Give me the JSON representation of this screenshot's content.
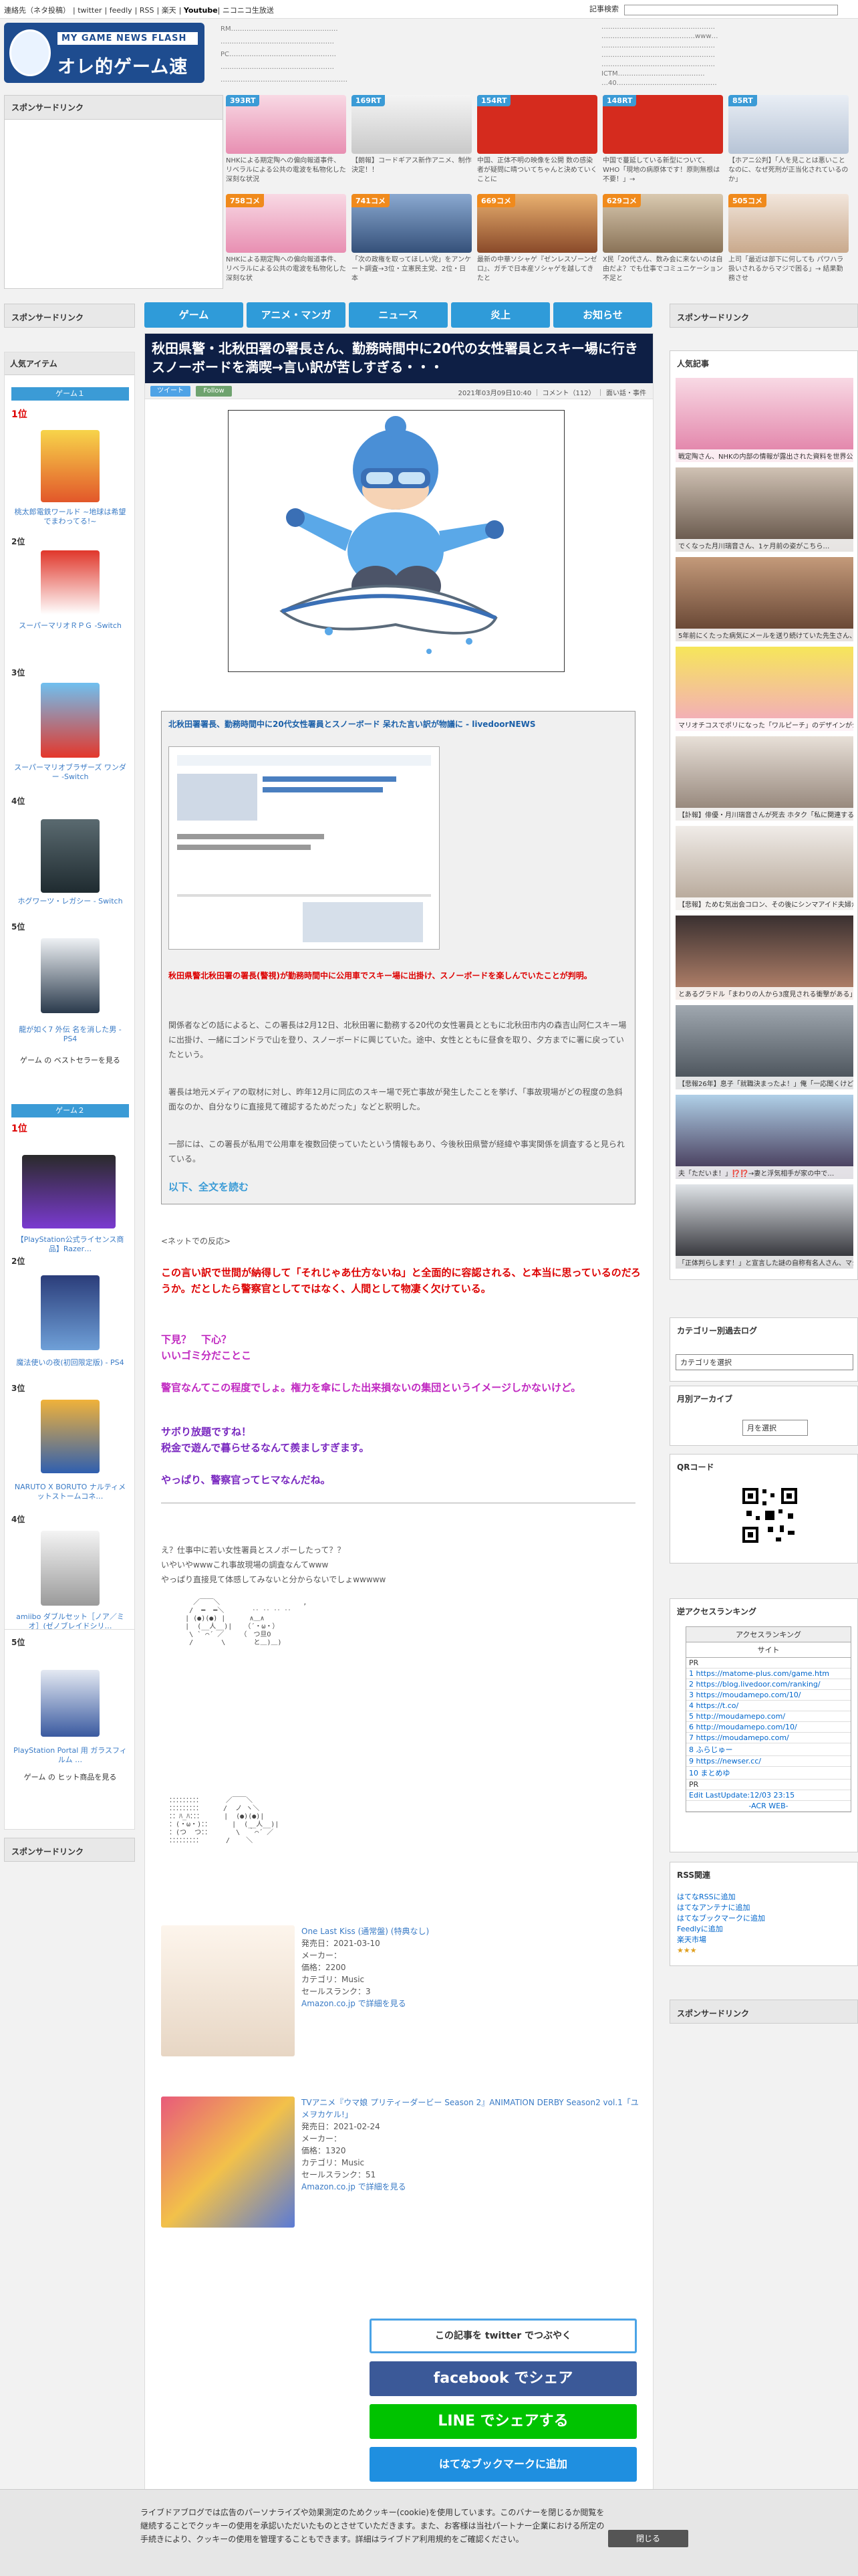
{
  "topbar": {
    "links": [
      "連絡先（ネタ投稿）",
      "twitter",
      "feedly",
      "RSS",
      "楽天",
      "Youtube",
      "ニコニコ生放送"
    ],
    "search_label": "記事検索"
  },
  "logo": {
    "line1": "MY GAME NEWS FLASH",
    "line2": "オレ的ゲーム速報@JIN"
  },
  "headlines_left": [
    "RM…………………………………………",
    "……………………………………………",
    "PC…………………………………………",
    "……………………………………………",
    "…………………………………………………"
  ],
  "headlines_right": [
    "……………………………………………",
    "……………………………………www…",
    "……………………………………………",
    "……………………………………………",
    "……………………………………………",
    "ICTM…………………………………",
    "…40………………………………………"
  ],
  "sponsored": "スポンサードリンク",
  "thumbs": [
    {
      "badge": "393RT",
      "caption": "NHKによる期定陶への偏向報道事件、リベラルによる公共の電波を私物化した深刻な状況"
    },
    {
      "badge": "169RT",
      "caption": "【朗報】コードギアス新作アニメ、制作決定！！"
    },
    {
      "badge": "154RT",
      "caption": "中国、正体不明の映像を公開 数の感染者が疑問に晴ついてちゃんと決めていくことに"
    },
    {
      "badge": "148RT",
      "caption": "中国で蔓延している新型について、WHO「現地の病原体です！原則無根は不要！」→"
    },
    {
      "badge": "85RT",
      "caption": "【ホアニ公判】「人を見ことは悪いことなのに、なぜ死刑が正当化されているのか」"
    },
    {
      "badge": "758コメ",
      "caption": "NHKによる期定陶への偏向報道事件、リベラルによる公共の電波を私物化した深刻な状"
    },
    {
      "badge": "741コメ",
      "caption": "「次の政権を取ってほしい党」をアンケート調査→3位・立憲民主党、2位・日本"
    },
    {
      "badge": "669コメ",
      "caption": "最新の中華ソシャゲ『ゼンレスゾーンゼロ』、ガチで日本産ソシャゲを越してきたと"
    },
    {
      "badge": "629コメ",
      "caption": "X民「20代さん、数み会に来ないのは自由だよ？でも仕事でコミュニケーション不足と"
    },
    {
      "badge": "505コメ",
      "caption": "上司「最近は部下に何しても パワハラ扱いされるからマジで困る」→ 結果勤務させ"
    }
  ],
  "nav": [
    "ゲーム",
    "アニメ・マンガ",
    "ニュース",
    "炎上",
    "お知らせ"
  ],
  "left": {
    "sponsored": "スポンサードリンク",
    "popular_items": "人気アイテム",
    "game1": "ゲーム１",
    "game2": "ゲーム２",
    "ranks": [
      "1位",
      "2位",
      "3位",
      "4位",
      "5位"
    ],
    "items1": [
      "桃太郎電鉄ワールド ~地球は希望でまわってる!~",
      "スーパーマリオＲＰＧ -Switch",
      "スーパーマリオブラザーズ ワンダー -Switch",
      "ホグワーツ・レガシー - Switch",
      "龍が如く7 外伝 名を消した男 - PS4"
    ],
    "more1": "ゲーム の ベストセラーを見る",
    "items2": [
      "【PlayStation公式ライセンス商品】Razer…",
      "魔法使いの夜(初回限定版) - PS4",
      "NARUTO X BORUTO ナルティメットストームコネ…",
      "amiibo ダブルセット［ノア／ミオ］(ゼノブレイドシリ…",
      "PlayStation Portal 用 ガラスフィルム …"
    ],
    "more2": "ゲーム の ヒット商品を見る",
    "sponsored2": "スポンサードリンク"
  },
  "article": {
    "title": "秋田県警・北秋田署の署長さん、勤務時間中に20代の女性署員とスキー場に行きスノーボードを満喫→言い訳が苦しすぎる・・・",
    "tweet": "ツイート",
    "follow": "Follow",
    "meta": "2021年03月09日10:40 ｜ コメント（112） ｜ 面い話・事件",
    "quote_title": "北秋田署署長、勤務時間中に20代女性署員とスノーボード 呆れた言い訳が物議に - livedoorNEWS",
    "quote_lead": "秋田県警北秋田署の署長(警視)が勤務時間中に公用車でスキー場に出掛け、スノーボードを楽しんでいたことが判明。",
    "quote_p1": "関係者などの話によると、この署長は2月12日、北秋田署に勤務する20代の女性署員とともに北秋田市内の森吉山阿仁スキー場に出掛け、一緒にゴンドラで山を登り、スノーボードに興じていた。途中、女性とともに昼食を取り、夕方までに署に戻っていたという。",
    "quote_p2": "署長は地元メディアの取材に対し、昨年12月に同広のスキー場で死亡事故が発生したことを挙げ、「事故現場がどの程度の急斜面なのか、自分なりに直接見て確認するためだった」などと釈明した。",
    "quote_p3": "一部には、この署長が私用で公用車を複数回使っていたという情報もあり、今後秋田県警が経緯や事実関係を調査すると見られている。",
    "readmore": "以下、全文を読む",
    "source": "<ネットでの反応>",
    "comments": [
      "この言い訳で世間が納得して「それじゃあ仕方ないね」と全面的に容認される、と本当に思っているのだろうか。だとしたら警察官としてではなく、人間として物凄く欠けている。",
      "下見？　下心？\nいいゴミ分だことこ",
      "警官なんてこの程度でしょ。権力を傘にした出来損ないの集団というイメージしかないけど。",
      "サボり放題ですね！\n税金で遊んで暮らせるなんて羨ましすぎます。",
      "やっぱり、警察官ってヒマなんだね。"
    ],
    "plain": "え？仕事中に若い女性署員とスノボーしたって？？\nいやいやwwwこれ事故現場の調査なんてwww\nやっぱり直接見て体感してみないと分からないでしょwwwww",
    "products": [
      {
        "title": "One Last Kiss (通常盤) (特典なし)",
        "date": "発売日：2021-03-10",
        "maker": "メーカー：",
        "price": "価格：2200",
        "cat": "カテゴリ：Music",
        "rank": "セールスランク：3",
        "link": "Amazon.co.jp で詳細を見る"
      },
      {
        "title": "TVアニメ『ウマ娘 プリティーダービー Season 2』ANIMATION DERBY Season2 vol.1「ユメヲカケル!」",
        "date": "発売日：2021-02-24",
        "maker": "メーカー：",
        "price": "価格：1320",
        "cat": "カテゴリ：Music",
        "rank": "セールスランク：51",
        "link": "Amazon.co.jp で詳細を見る"
      }
    ],
    "share": {
      "twitter": "この記事を twitter でつぶやく",
      "facebook": "facebook でシェア",
      "line": "LINE でシェアする",
      "hatena": "はてなブックマークに追加"
    }
  },
  "right": {
    "sponsored": "スポンサードリンク",
    "popular": "人気記事",
    "popular_items": [
      "戦定陶さん、NHKの内部の情報が露出された資料を世界公開→マジで異質になりかねない事態に",
      "でくなった月川瑞音さん、1ヶ月前の姿がこちら…",
      "5年前にくたった病気にメールを送り続けていた先生さん、ある日、来るはずもない\"3文字の返事\"",
      "マリオチコスでポリになった「ワルピーチ」のデザインが公開される！問題点は",
      "【訃報】俳優・月川瑞音さんが死去 ホタク「私に関連する日曜」の勤事務管理で",
      "【悲報】ためむ気出会コロン、その後にシンマアイド夫婦か、解散時に亡くなる",
      "とあるグラドル「まわりの人から3度見される衝撃がある」",
      "【悲報26年】息子「就職決まったよ！」俺「一応聞くけど...」",
      "夫「ただいま！」⁉️⁉️→妻と浮気相手が家の中で…",
      "「正体判らします！」と宣言した謎の自称有名人さん、マジで本名が…"
    ],
    "category": "カテゴリー別過去ログ",
    "category_select": "カテゴリを選択",
    "monthly": "月別アーカイブ",
    "monthly_select": "月を選択",
    "qr": "QRコード",
    "ranking": "逆アクセスランキング",
    "ranking_head": "アクセスランキング",
    "ranking_sub": "サイト",
    "ranking_rows": [
      "PR",
      "1 https://matome-plus.com/game.htm",
      "2 https://blog.livedoor.com/ranking/",
      "3 https://moudamepo.com/10/",
      "4 https://t.co/",
      "5 http://moudamepo.com/",
      "6 http://moudamepo.com/10/",
      "7 https://moudamepo.com/",
      "8 ふらじゅー",
      "9 https://newser.cc/",
      "10 まとめゆ",
      "PR",
      "Edit LastUpdate:12/03 23:15",
      "-ACR WEB-"
    ],
    "rss": "RSS関連",
    "rss_links": [
      "はてなRSSに追加",
      "はてなアンテナに追加",
      "はてなブックマークに追加",
      "Feedlyに追加",
      "楽天市場"
    ],
    "sponsored2": "スポンサードリンク"
  },
  "cookie": {
    "text": "ライブドアブログでは広告のパーソナライズや効果測定のためクッキー(cookie)を使用しています。このバナーを閉じるか閲覧を継続することでクッキーの使用を承認いただいたものとさせていただきます。また、お客様は当社パートナー企業における所定の手続きにより、クッキーの使用を管理することもできます。詳細はライブドア利用規約をご確認ください。",
    "close": "閉じる"
  }
}
